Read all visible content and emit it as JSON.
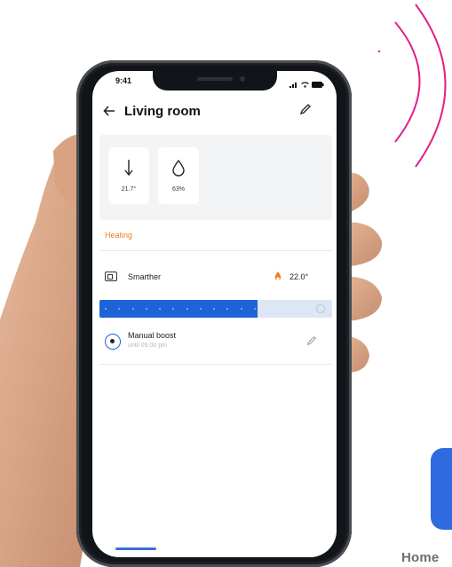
{
  "status_bar": {
    "time": "9:41"
  },
  "header": {
    "back_icon": "arrow-left-icon",
    "title": "Living room",
    "edit_icon": "pencil-icon"
  },
  "sensors": [
    {
      "icon": "thermometer-icon",
      "value": "21.7°"
    },
    {
      "icon": "humidity-drop-icon",
      "value": "63%"
    }
  ],
  "section": {
    "label": "Heating"
  },
  "thermostat": {
    "name": "Smarther",
    "icon": "thermostat-icon",
    "flame_icon": "flame-icon",
    "temperature": "22.0°"
  },
  "slider": {
    "level_fraction": 0.68
  },
  "boost": {
    "title": "Manual boost",
    "subtitle": "until 05:00 pm",
    "icon": "boost-icon",
    "edit_icon": "pencil-icon"
  },
  "footer": {
    "label": "Home"
  },
  "colors": {
    "accent": "#1e63d8",
    "heating": "#f07d1e",
    "signal": "#e0218a"
  }
}
